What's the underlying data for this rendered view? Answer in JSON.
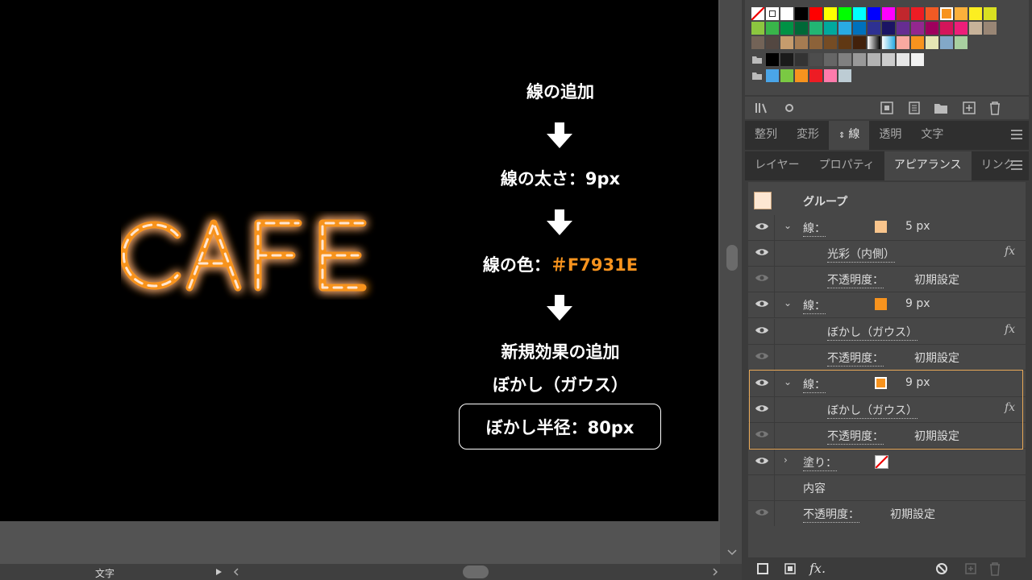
{
  "artboard": {
    "neon_text": "CAFE",
    "steps": [
      "線の追加",
      "線の太さ：9px",
      "線の色：",
      "新規効果の追加",
      "ぼかし（ガウス）"
    ],
    "color_hex": "＃F7931E",
    "color_accent": "#F7931E",
    "radius_label": "ぼかし半径：80px"
  },
  "status": {
    "mode": "文字"
  },
  "panel_tabs_1": [
    "整列",
    "変形",
    "線",
    "透明",
    "文字"
  ],
  "panel_tabs_2": [
    "レイヤー",
    "プロパティ",
    "アピアランス",
    "リンク"
  ],
  "appearance": {
    "group_label": "グループ",
    "rows": [
      {
        "label": "線：",
        "value": "5 px",
        "chip": "#F9C58C"
      },
      {
        "label": "光彩（内側）",
        "fx": "fx"
      },
      {
        "label": "不透明度：",
        "value": "初期設定"
      },
      {
        "label": "線：",
        "value": "9 px",
        "chip": "#F7931E"
      },
      {
        "label": "ぼかし（ガウス）",
        "fx": "fx"
      },
      {
        "label": "不透明度：",
        "value": "初期設定"
      },
      {
        "label": "線：",
        "value": "9 px",
        "chip": "#F7931E"
      },
      {
        "label": "ぼかし（ガウス）",
        "fx": "fx"
      },
      {
        "label": "不透明度：",
        "value": "初期設定"
      },
      {
        "label": "塗り："
      },
      {
        "label": "内容"
      },
      {
        "label": "不透明度：",
        "value": "初期設定"
      }
    ]
  }
}
